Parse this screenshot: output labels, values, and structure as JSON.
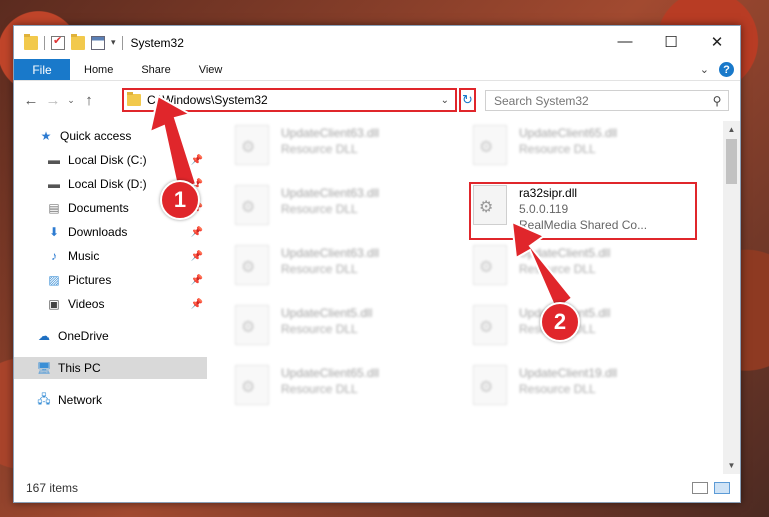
{
  "window": {
    "title": "System32"
  },
  "controls": {
    "minimize": "—",
    "maximize": "☐",
    "close": "✕"
  },
  "ribbon": {
    "tabs": [
      "File",
      "Home",
      "Share",
      "View"
    ],
    "help": "?"
  },
  "nav": {
    "back": "←",
    "forward": "→",
    "recent": "⌄",
    "up": "↑"
  },
  "address": {
    "path": "C:\\Windows\\System32"
  },
  "search": {
    "placeholder": "Search System32"
  },
  "sidebar": {
    "items": [
      {
        "label": "Quick access"
      },
      {
        "label": "Local Disk (C:)"
      },
      {
        "label": "Local Disk (D:)"
      },
      {
        "label": "Documents"
      },
      {
        "label": "Downloads"
      },
      {
        "label": "Music"
      },
      {
        "label": "Pictures"
      },
      {
        "label": "Videos"
      },
      {
        "label": "OneDrive"
      },
      {
        "label": "This PC"
      },
      {
        "label": "Network"
      }
    ]
  },
  "files": [
    {
      "name": "UpdateClient63.dll",
      "meta": "Resource DLL"
    },
    {
      "name": "UpdateClient65.dll",
      "meta": "Resource DLL"
    },
    {
      "name": "UpdateClient63.dll",
      "meta": "Resource DLL"
    },
    {
      "name": "ra32sipr.dll",
      "version": "5.0.0.119",
      "desc": "RealMedia Shared Co..."
    },
    {
      "name": "UpdateClient63.dll",
      "meta": "Resource DLL"
    },
    {
      "name": "UpdateClient5.dll",
      "meta": "Resource DLL"
    },
    {
      "name": "UpdateClient5.dll",
      "meta": "Resource DLL"
    },
    {
      "name": "UpdateClient5.dll",
      "meta": "Resource DLL"
    },
    {
      "name": "UpdateClient65.dll",
      "meta": "Resource DLL"
    },
    {
      "name": "UpdateClient19.dll",
      "meta": "Resource DLL"
    }
  ],
  "status": {
    "count": "167 items"
  },
  "callouts": [
    "1",
    "2"
  ],
  "colors": {
    "accent": "#1979ca",
    "highlight": "#e0262b"
  }
}
